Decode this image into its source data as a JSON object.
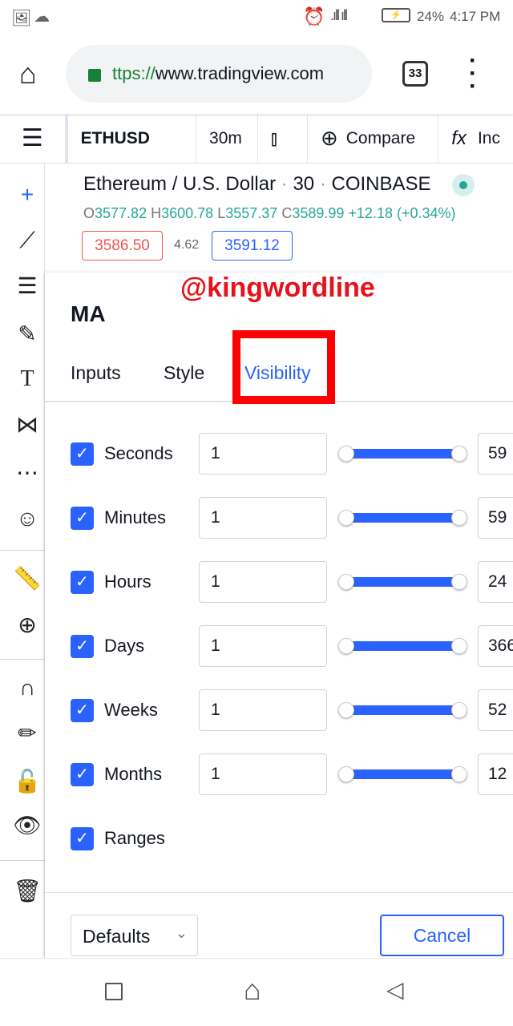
{
  "status": {
    "battery": "24%",
    "time": "4:17 PM"
  },
  "browser": {
    "url_scheme": "ttps://",
    "url_host": "www.tradingview.com",
    "tab_count": "33"
  },
  "toolbar": {
    "symbol": "ETHUSD",
    "interval": "30m",
    "compare": "Compare",
    "indicators": "Inc"
  },
  "chart": {
    "title": "Ethereum / U.S. Dollar",
    "interval": "30",
    "exchange": "COINBASE",
    "dot": "·",
    "o_label": "O",
    "o": "3577.82",
    "h_label": "H",
    "h": "3600.78",
    "l_label": "L",
    "l": "3557.37",
    "c_label": "C",
    "c": "3589.99",
    "change": "+12.18 (+0.34%)",
    "sell": "3586.50",
    "spread": "4.62",
    "buy": "3591.12"
  },
  "watermark": "@kingwordline",
  "dialog": {
    "title": "MA",
    "tabs": [
      "Inputs",
      "Style",
      "Visibility"
    ],
    "active_tab": "Visibility",
    "rows": [
      {
        "label": "Seconds",
        "min": "1",
        "max": "59",
        "checked": true
      },
      {
        "label": "Minutes",
        "min": "1",
        "max": "59",
        "checked": true
      },
      {
        "label": "Hours",
        "min": "1",
        "max": "24",
        "checked": true
      },
      {
        "label": "Days",
        "min": "1",
        "max": "366",
        "checked": true
      },
      {
        "label": "Weeks",
        "min": "1",
        "max": "52",
        "checked": true
      },
      {
        "label": "Months",
        "min": "1",
        "max": "12",
        "checked": true
      },
      {
        "label": "Ranges",
        "checked": true
      }
    ],
    "defaults": "Defaults",
    "cancel": "Cancel"
  },
  "colors": {
    "accent": "#2962ff",
    "green": "#26a69a",
    "red": "#ef5350",
    "highlight": "#ff0000",
    "lock": "#188038"
  }
}
